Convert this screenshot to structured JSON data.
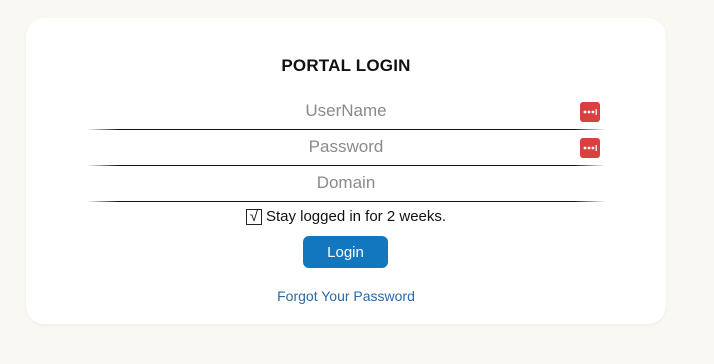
{
  "login": {
    "title": "PORTAL LOGIN",
    "username_placeholder": "UserName",
    "password_placeholder": "Password",
    "domain_placeholder": "Domain",
    "stay_logged_in_label": "Stay logged in for 2 weeks.",
    "stay_logged_in_checked": true,
    "checkbox_mark": "√",
    "login_button_label": "Login",
    "forgot_password_link": "Forgot Your Password"
  },
  "icons": {
    "password_manager_icon": "password-manager-icon"
  },
  "colors": {
    "page_background": "#faf8f3",
    "card_background": "#ffffff",
    "login_button": "#1377bf",
    "link": "#2a6aa8",
    "password_manager_icon": "#d94040"
  }
}
